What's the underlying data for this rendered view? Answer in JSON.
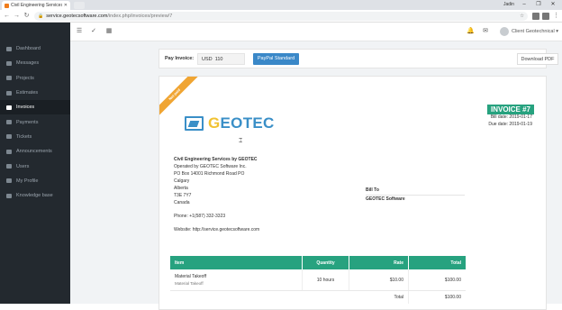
{
  "browser": {
    "tab_title": "Civil Engineering Services",
    "url_host": "service.geotecsoftware.com",
    "url_path": "/index.php/invoices/preview/7",
    "window_user": "Jadin"
  },
  "brand": {
    "logo_text_1": "G",
    "logo_text_2": "EOTEC"
  },
  "sidebar": {
    "items": [
      {
        "label": "Dashboard"
      },
      {
        "label": "Messages"
      },
      {
        "label": "Projects"
      },
      {
        "label": "Estimates"
      },
      {
        "label": "Invoices"
      },
      {
        "label": "Payments"
      },
      {
        "label": "Tickets"
      },
      {
        "label": "Announcements"
      },
      {
        "label": "Users"
      },
      {
        "label": "My Profile"
      },
      {
        "label": "Knowledge base"
      }
    ],
    "active_index": 4
  },
  "header": {
    "client_name": "Client Geotechnical"
  },
  "payment": {
    "label": "Pay Invoice:",
    "currency": "USD",
    "amount": "110",
    "paypal_label": "PayPal Standard",
    "download_label": "Download PDF"
  },
  "invoice": {
    "ribbon": "Not paid",
    "title": "INVOICE #7",
    "bill_date": "Bill date: 2019-01-17",
    "due_date": "Due date: 2019-01-19",
    "from": {
      "name": "Civil Engineering Services by GEOTEC",
      "line1": "Operated by GEOTEC Software Inc.",
      "line2": "PO Box 14001 Richmond Road PO",
      "line3": "Calgary",
      "line4": "Alberta",
      "line5": "T3E 7Y7",
      "line6": "Canada",
      "phone": "Phone: +1(587) 332-3323",
      "website": "Website: http://service.geotecsoftware.com"
    },
    "bill_to": {
      "label": "Bill To",
      "name": "GEOTEC Software"
    },
    "table": {
      "headers": {
        "item": "Item",
        "quantity": "Quantity",
        "rate": "Rate",
        "total": "Total"
      },
      "rows": [
        {
          "item": "Material Takeoff",
          "desc": "Material Takeoff",
          "quantity": "10 hours",
          "rate": "$10.00",
          "total": "$100.00"
        }
      ],
      "total_label": "Total",
      "total_value": "$100.00"
    }
  }
}
